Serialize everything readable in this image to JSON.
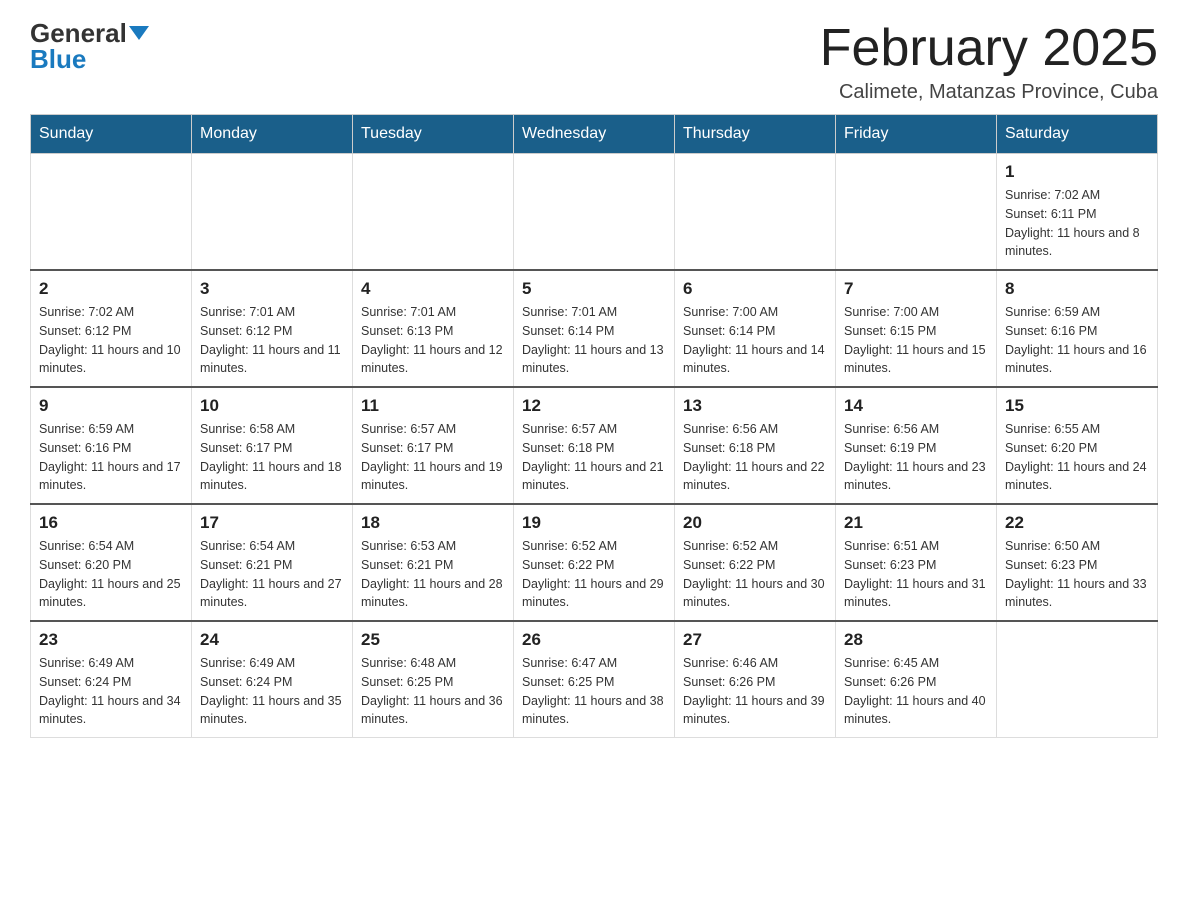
{
  "header": {
    "logo_general": "General",
    "logo_blue": "Blue",
    "month_title": "February 2025",
    "location": "Calimete, Matanzas Province, Cuba"
  },
  "days_of_week": [
    "Sunday",
    "Monday",
    "Tuesday",
    "Wednesday",
    "Thursday",
    "Friday",
    "Saturday"
  ],
  "weeks": [
    [
      {
        "day": "",
        "info": ""
      },
      {
        "day": "",
        "info": ""
      },
      {
        "day": "",
        "info": ""
      },
      {
        "day": "",
        "info": ""
      },
      {
        "day": "",
        "info": ""
      },
      {
        "day": "",
        "info": ""
      },
      {
        "day": "1",
        "info": "Sunrise: 7:02 AM\nSunset: 6:11 PM\nDaylight: 11 hours and 8 minutes."
      }
    ],
    [
      {
        "day": "2",
        "info": "Sunrise: 7:02 AM\nSunset: 6:12 PM\nDaylight: 11 hours and 10 minutes."
      },
      {
        "day": "3",
        "info": "Sunrise: 7:01 AM\nSunset: 6:12 PM\nDaylight: 11 hours and 11 minutes."
      },
      {
        "day": "4",
        "info": "Sunrise: 7:01 AM\nSunset: 6:13 PM\nDaylight: 11 hours and 12 minutes."
      },
      {
        "day": "5",
        "info": "Sunrise: 7:01 AM\nSunset: 6:14 PM\nDaylight: 11 hours and 13 minutes."
      },
      {
        "day": "6",
        "info": "Sunrise: 7:00 AM\nSunset: 6:14 PM\nDaylight: 11 hours and 14 minutes."
      },
      {
        "day": "7",
        "info": "Sunrise: 7:00 AM\nSunset: 6:15 PM\nDaylight: 11 hours and 15 minutes."
      },
      {
        "day": "8",
        "info": "Sunrise: 6:59 AM\nSunset: 6:16 PM\nDaylight: 11 hours and 16 minutes."
      }
    ],
    [
      {
        "day": "9",
        "info": "Sunrise: 6:59 AM\nSunset: 6:16 PM\nDaylight: 11 hours and 17 minutes."
      },
      {
        "day": "10",
        "info": "Sunrise: 6:58 AM\nSunset: 6:17 PM\nDaylight: 11 hours and 18 minutes."
      },
      {
        "day": "11",
        "info": "Sunrise: 6:57 AM\nSunset: 6:17 PM\nDaylight: 11 hours and 19 minutes."
      },
      {
        "day": "12",
        "info": "Sunrise: 6:57 AM\nSunset: 6:18 PM\nDaylight: 11 hours and 21 minutes."
      },
      {
        "day": "13",
        "info": "Sunrise: 6:56 AM\nSunset: 6:18 PM\nDaylight: 11 hours and 22 minutes."
      },
      {
        "day": "14",
        "info": "Sunrise: 6:56 AM\nSunset: 6:19 PM\nDaylight: 11 hours and 23 minutes."
      },
      {
        "day": "15",
        "info": "Sunrise: 6:55 AM\nSunset: 6:20 PM\nDaylight: 11 hours and 24 minutes."
      }
    ],
    [
      {
        "day": "16",
        "info": "Sunrise: 6:54 AM\nSunset: 6:20 PM\nDaylight: 11 hours and 25 minutes."
      },
      {
        "day": "17",
        "info": "Sunrise: 6:54 AM\nSunset: 6:21 PM\nDaylight: 11 hours and 27 minutes."
      },
      {
        "day": "18",
        "info": "Sunrise: 6:53 AM\nSunset: 6:21 PM\nDaylight: 11 hours and 28 minutes."
      },
      {
        "day": "19",
        "info": "Sunrise: 6:52 AM\nSunset: 6:22 PM\nDaylight: 11 hours and 29 minutes."
      },
      {
        "day": "20",
        "info": "Sunrise: 6:52 AM\nSunset: 6:22 PM\nDaylight: 11 hours and 30 minutes."
      },
      {
        "day": "21",
        "info": "Sunrise: 6:51 AM\nSunset: 6:23 PM\nDaylight: 11 hours and 31 minutes."
      },
      {
        "day": "22",
        "info": "Sunrise: 6:50 AM\nSunset: 6:23 PM\nDaylight: 11 hours and 33 minutes."
      }
    ],
    [
      {
        "day": "23",
        "info": "Sunrise: 6:49 AM\nSunset: 6:24 PM\nDaylight: 11 hours and 34 minutes."
      },
      {
        "day": "24",
        "info": "Sunrise: 6:49 AM\nSunset: 6:24 PM\nDaylight: 11 hours and 35 minutes."
      },
      {
        "day": "25",
        "info": "Sunrise: 6:48 AM\nSunset: 6:25 PM\nDaylight: 11 hours and 36 minutes."
      },
      {
        "day": "26",
        "info": "Sunrise: 6:47 AM\nSunset: 6:25 PM\nDaylight: 11 hours and 38 minutes."
      },
      {
        "day": "27",
        "info": "Sunrise: 6:46 AM\nSunset: 6:26 PM\nDaylight: 11 hours and 39 minutes."
      },
      {
        "day": "28",
        "info": "Sunrise: 6:45 AM\nSunset: 6:26 PM\nDaylight: 11 hours and 40 minutes."
      },
      {
        "day": "",
        "info": ""
      }
    ]
  ]
}
